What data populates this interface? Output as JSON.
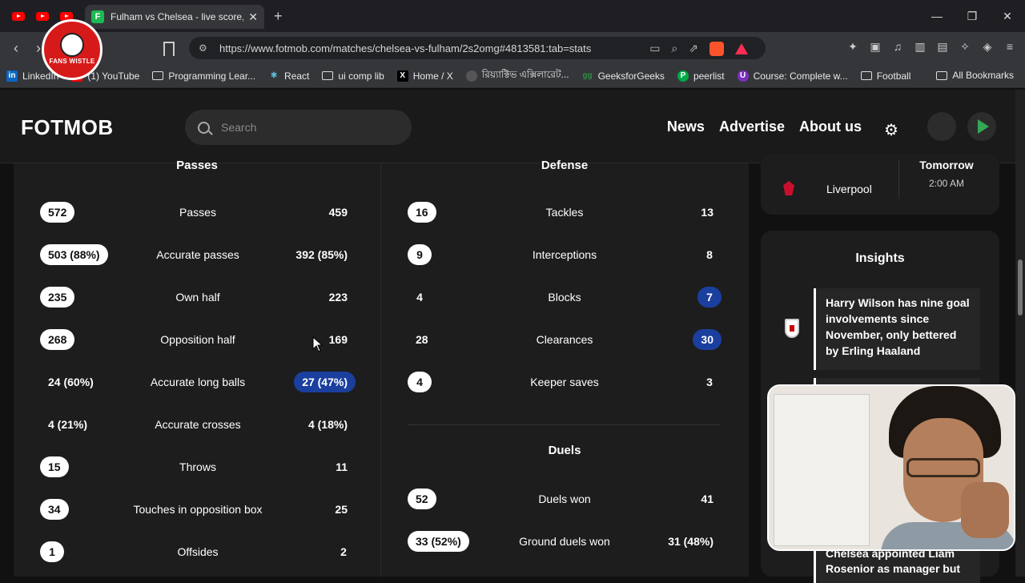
{
  "browser": {
    "tab_title": "Fulham vs Chelsea - live score, p",
    "tab_favicon": "fotmob-icon",
    "url": "https://www.fotmob.com/matches/chelsea-vs-fulham/2s2omg#4813581:tab=stats",
    "bookmarks": [
      {
        "label": "LinkedIn",
        "icon": "in"
      },
      {
        "label": "(1) YouTube",
        "icon": "youtube"
      },
      {
        "label": "Programming Lear...",
        "icon": "folder"
      },
      {
        "label": "React",
        "icon": "react"
      },
      {
        "label": "ui comp lib",
        "icon": "folder"
      },
      {
        "label": "Home / X",
        "icon": "x"
      },
      {
        "label": "রিয়্যাক্টিভ এক্সিলারেট...",
        "icon": "avatar"
      },
      {
        "label": "GeeksforGeeks",
        "icon": "gfg"
      },
      {
        "label": "peerlist",
        "icon": "p"
      },
      {
        "label": "Course: Complete w...",
        "icon": "course"
      },
      {
        "label": "Football",
        "icon": "folder"
      }
    ],
    "all_bookmarks": "All Bookmarks",
    "channel_logo_text": "FANS WISTLE"
  },
  "header": {
    "logo": "FOTMOB",
    "search_placeholder": "Search",
    "nav": [
      "News",
      "Advertise",
      "About us"
    ]
  },
  "passes": {
    "title": "Passes",
    "rows": [
      {
        "label": "Passes",
        "home": "572",
        "away": "459",
        "highlight": "home"
      },
      {
        "label": "Accurate passes",
        "home": "503 (88%)",
        "away": "392 (85%)",
        "highlight": "home"
      },
      {
        "label": "Own half",
        "home": "235",
        "away": "223",
        "highlight": "home"
      },
      {
        "label": "Opposition half",
        "home": "268",
        "away": "169",
        "highlight": "home"
      },
      {
        "label": "Accurate long balls",
        "home": "24 (60%)",
        "away": "27 (47%)",
        "highlight": "away"
      },
      {
        "label": "Accurate crosses",
        "home": "4 (21%)",
        "away": "4 (18%)",
        "highlight": "none"
      },
      {
        "label": "Throws",
        "home": "15",
        "away": "11",
        "highlight": "home"
      },
      {
        "label": "Touches in opposition box",
        "home": "34",
        "away": "25",
        "highlight": "home"
      },
      {
        "label": "Offsides",
        "home": "1",
        "away": "2",
        "highlight": "home"
      }
    ]
  },
  "defense": {
    "title": "Defense",
    "rows": [
      {
        "label": "Tackles",
        "home": "16",
        "away": "13",
        "highlight": "home"
      },
      {
        "label": "Interceptions",
        "home": "9",
        "away": "8",
        "highlight": "home"
      },
      {
        "label": "Blocks",
        "home": "4",
        "away": "7",
        "highlight": "away"
      },
      {
        "label": "Clearances",
        "home": "28",
        "away": "30",
        "highlight": "away"
      },
      {
        "label": "Keeper saves",
        "home": "4",
        "away": "3",
        "highlight": "home"
      }
    ]
  },
  "duels": {
    "title": "Duels",
    "rows": [
      {
        "label": "Duels won",
        "home": "52",
        "away": "41",
        "highlight": "home"
      },
      {
        "label": "Ground duels won",
        "home": "33 (52%)",
        "away": "31 (48%)",
        "highlight": "home"
      }
    ]
  },
  "sidebar": {
    "match": {
      "team": "Liverpool",
      "day": "Tomorrow",
      "time": "2:00 AM"
    },
    "insights_title": "Insights",
    "insight_1": "Harry Wilson has nine goal involvements since November, only bettered by Erling Haaland",
    "insight_3": "Chelsea appointed Liam Rosenior as manager but"
  },
  "colors": {
    "home_pill": "#ffffff",
    "away_pill": "#1b3f9e",
    "page_bg": "#111111",
    "card_bg": "#1d1d1d"
  }
}
